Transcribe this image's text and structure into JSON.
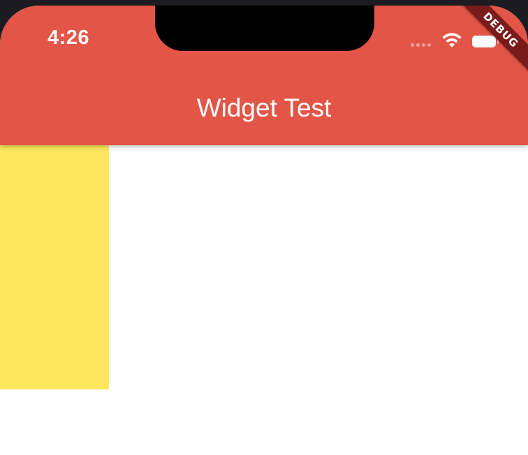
{
  "status_bar": {
    "time": "4:26",
    "icons": [
      "signal-dots-icon",
      "wifi-icon",
      "battery-icon"
    ]
  },
  "app_bar": {
    "title": "Widget Test",
    "color": "#e35546"
  },
  "debug_banner": {
    "label": "DEBUG",
    "color": "#7a1b1b"
  },
  "body": {
    "box_color": "#fde75c",
    "background": "#ffffff"
  }
}
